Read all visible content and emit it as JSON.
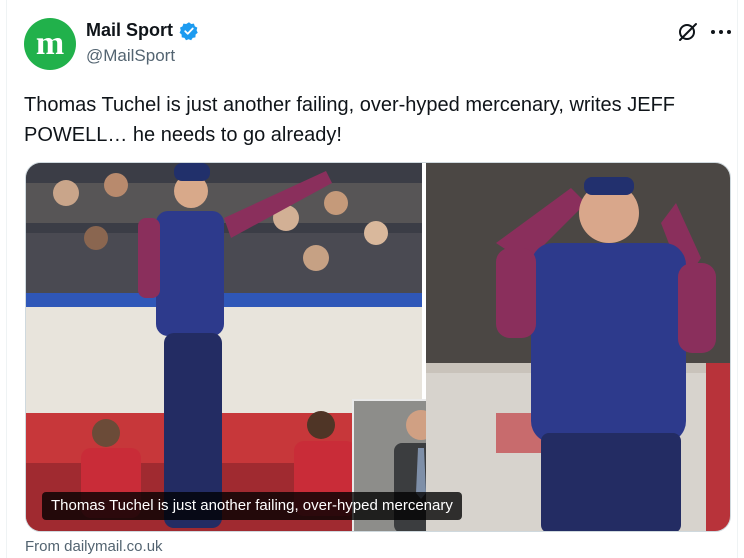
{
  "account": {
    "name": "Mail Sport",
    "handle": "@MailSport",
    "avatar_letters": "m",
    "avatar_color": "#21b14b",
    "verified_color": "#1d9bf0"
  },
  "actions": {
    "grok_icon": "grok-icon",
    "more_icon": "more-icon"
  },
  "tweet": {
    "text": "Thomas Tuchel is just another failing, over-hyped mercenary, writes JEFF POWELL… he needs to go already!"
  },
  "card": {
    "caption": "Thomas Tuchel is just another failing, over-hyped mercenary",
    "source": "From dailymail.co.uk"
  }
}
